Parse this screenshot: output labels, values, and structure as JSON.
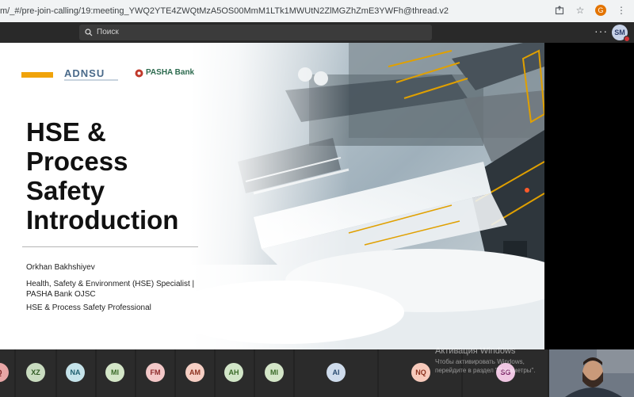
{
  "browser": {
    "url": "m/_#/pre-join-calling/19:meeting_YWQ2YTE4ZWQtMzA5OS00MmM1LTk1MWUtN2ZlMGZhZmE3YWFh@thread.v2",
    "profile_initial": "G"
  },
  "header": {
    "search_placeholder": "Поиск",
    "user_initials": "SM"
  },
  "slide": {
    "logo_left": "ADNSU",
    "logo_right": "PASHA Bank",
    "title_lines": [
      "HSE &",
      "Process",
      "Safety",
      "Introduction"
    ],
    "author": "Orkhan Bakhshiyev",
    "role": "Health, Safety & Environment (HSE) Specialist | PASHA Bank OJSC",
    "profession": "HSE & Process Safety Professional",
    "accent_color": "#f0a30a"
  },
  "participants": [
    {
      "initials": "Q",
      "color": "#e8a6a6",
      "text": "#7a2020"
    },
    {
      "initials": "XZ",
      "color": "#c9dcc0",
      "text": "#2f5a22"
    },
    {
      "initials": "NA",
      "color": "#c5e3ea",
      "text": "#1d5e6e"
    },
    {
      "initials": "MI",
      "color": "#d4e6c8",
      "text": "#3a6a28"
    },
    {
      "initials": "FM",
      "color": "#f3c8c8",
      "text": "#8c2a2a"
    },
    {
      "initials": "AM",
      "color": "#f6cfc4",
      "text": "#8c3320"
    },
    {
      "initials": "AH",
      "color": "#d2e6c8",
      "text": "#3a6a28"
    },
    {
      "initials": "MI",
      "color": "#d4e6c8",
      "text": "#3a6a28"
    },
    {
      "initials": "AI",
      "color": "#cfdcec",
      "text": "#294a70"
    },
    {
      "initials": "NQ",
      "color": "#f7cabb",
      "text": "#8c3320"
    },
    {
      "initials": "SG",
      "color": "#efc6e2",
      "text": "#7a2566"
    }
  ],
  "windows_watermark": {
    "title": "Активация Windows",
    "text": "Чтобы активировать Windows, перейдите в раздел \"Параметры\"."
  }
}
